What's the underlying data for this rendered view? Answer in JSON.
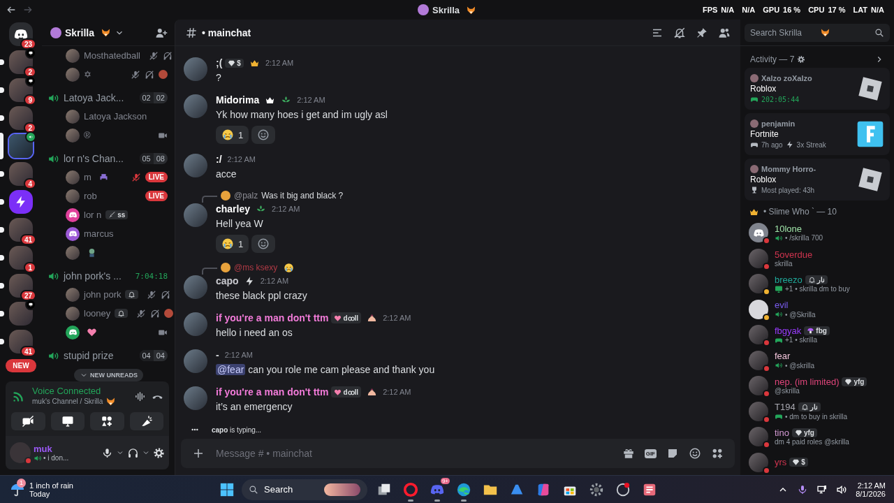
{
  "topbar": {
    "title": "Skrilla",
    "stats": [
      {
        "label": "FPS",
        "value": "N/A"
      },
      {
        "value": "N/A"
      },
      {
        "label": "GPU",
        "value": "16 %"
      },
      {
        "label": "CPU",
        "value": "17 %"
      },
      {
        "label": "LAT",
        "value": "N/A"
      }
    ]
  },
  "servers": [
    {
      "kind": "home",
      "badge": "23",
      "unread": false,
      "selected": false
    },
    {
      "kind": "photo",
      "badge": "2",
      "unread": true,
      "selected": false
    },
    {
      "kind": "photo",
      "badge": "9",
      "unread": true,
      "selected": false
    },
    {
      "kind": "photo",
      "badge": "2",
      "unread": true,
      "selected": false
    },
    {
      "kind": "photo",
      "unread": false,
      "selected": true
    },
    {
      "kind": "photo",
      "badge": "4",
      "unread": true,
      "selected": false
    },
    {
      "kind": "logo",
      "unread": true,
      "selected": false
    },
    {
      "kind": "photo",
      "badge": "41",
      "unread": true,
      "selected": false
    },
    {
      "kind": "photo",
      "badge": "1",
      "unread": true,
      "selected": false
    },
    {
      "kind": "photo",
      "badge": "27",
      "unread": true,
      "selected": false
    },
    {
      "kind": "photo",
      "unread": true,
      "selected": false
    },
    {
      "kind": "photo",
      "badge": "41",
      "unread": true,
      "selected": false
    }
  ],
  "new_pill": "NEW",
  "sidebar": {
    "server_name": "Skrilla",
    "channels": [
      {
        "members": [
          {
            "name": "Mosthatedball",
            "kind": "photo",
            "muted": true,
            "deafened": true,
            "camera": false,
            "activity": false
          },
          {
            "name": "✡",
            "kind": "photo",
            "muted": true,
            "deafened": true,
            "camera": false,
            "activity": true
          }
        ]
      },
      {
        "name": "Latoya Jack...",
        "count": [
          "02",
          "02"
        ],
        "members": [
          {
            "name": "Latoya Jackson",
            "kind": "photo",
            "muted": false,
            "deafened": false,
            "camera": false,
            "activity": false
          },
          {
            "name": "®",
            "kind": "photo",
            "muted": false,
            "deafened": false,
            "camera": true,
            "activity": false
          }
        ]
      },
      {
        "name": "lor n's Chan...",
        "count": [
          "05",
          "08"
        ],
        "members": [
          {
            "name": "m",
            "kind": "photo",
            "muted": true,
            "deafened": false,
            "camera": false,
            "activity": false,
            "live": "LIVE"
          },
          {
            "name": "rob",
            "kind": "photo",
            "muted": false,
            "deafened": false,
            "camera": false,
            "activity": false,
            "live": "LIVE"
          },
          {
            "name": "lor n",
            "tag": {
              "text": "ss"
            },
            "kind": "discord",
            "color": "#e0409b",
            "muted": false,
            "deafened": false,
            "camera": false,
            "activity": false
          },
          {
            "name": "marcus",
            "kind": "discord",
            "color": "#9b59d6",
            "muted": false,
            "deafened": false,
            "camera": false,
            "activity": false
          },
          {
            "kind": "photo",
            "muted": false,
            "deafened": false,
            "camera": false,
            "activity": false
          }
        ]
      },
      {
        "name": "john pork's ...",
        "timer": "7:04:18",
        "members": [
          {
            "name": "john pork",
            "tag": true,
            "kind": "photo",
            "muted": true,
            "deafened": true,
            "camera": false,
            "activity": false
          },
          {
            "name": "looney",
            "tag": true,
            "kind": "photo",
            "muted": true,
            "deafened": true,
            "camera": false,
            "activity": true
          },
          {
            "kind": "discord",
            "color": "#23a55a",
            "muted": false,
            "deafened": false,
            "camera": true,
            "activity": false
          }
        ]
      },
      {
        "name": "stupid prize",
        "count": [
          "04",
          "04"
        ]
      }
    ],
    "unreads": "NEW UNREADS",
    "voice": {
      "title": "Voice Connected",
      "subtitle": "muk's Channel / Skrilla"
    },
    "user": {
      "name": "muk",
      "status": "• i don..."
    }
  },
  "channel": {
    "name": "• mainchat",
    "search_placeholder": "Search Skrilla"
  },
  "messages": [
    {
      "author": ";(",
      "color": "#dbdee1",
      "tag": {
        "text": "$"
      },
      "time": "2:12 AM",
      "text": "?"
    },
    {
      "author": "Midorima",
      "color": "#ffffff",
      "time": "2:12 AM",
      "text": "Yk how many hoes i get and im ugly asl",
      "reactions": [
        {
          "count": "1"
        }
      ]
    },
    {
      "author": ":/",
      "color": "#ffffff",
      "time": "2:12 AM",
      "text": "acce"
    },
    {
      "reply": {
        "author": "@palz",
        "color": "#8e8e96",
        "text": "Was it big and black ?"
      },
      "author": "charley",
      "color": "#ffffff",
      "time": "2:12 AM",
      "text": "Hell yea W",
      "reactions": [
        {
          "count": "1"
        }
      ]
    },
    {
      "reply": {
        "author": "@ms ksexy",
        "color": "#b03a45"
      },
      "author": "capo",
      "color": "#c9c9cf",
      "time": "2:12 AM",
      "text": "these black ppl crazy"
    },
    {
      "author": "if you're a man don't ttm",
      "color": "#f27bd9",
      "tag": {
        "text": "dꝏll"
      },
      "time": "2:12 AM",
      "text": "hello i need an os"
    },
    {
      "author": "-",
      "color": "#dbdee1",
      "time": "2:12 AM",
      "mention": "@fear",
      "text": "can you role me cam please and thank you"
    },
    {
      "author": "if you're a man don't ttm",
      "color": "#f27bd9",
      "tag": {
        "text": "dꝏll"
      },
      "time": "2:12 AM",
      "text": "it’s an emergency"
    }
  ],
  "typing": "**capo** is typing...",
  "composer": {
    "placeholder": "Message # • mainchat",
    "gif": "GIF"
  },
  "activity": {
    "title": "Activity — 7",
    "cards": [
      {
        "user": "Xalzo zoXalzo",
        "game": "Roblox",
        "kind": "timer",
        "detail": "202:05:44"
      },
      {
        "user": "penjamin",
        "game": "Fortnite",
        "kind": "recent",
        "detail": "7h ago",
        "extra": "3x Streak"
      },
      {
        "user": "Mommy Horro-",
        "game": "Roblox",
        "kind": "played",
        "detail": "Most played: 43h"
      }
    ]
  },
  "members": {
    "title": "• Slime Who ` — 10",
    "items": [
      {
        "name": "10lone",
        "color": "#9fe3a8",
        "kind": "discord",
        "idle": false,
        "activity": {
          "kind": "voice",
          "text": "• /skrilla 700"
        }
      },
      {
        "name": "5overdue",
        "color": "#d0344f",
        "kind": "photo",
        "idle": false,
        "activity": {
          "text": "skrilla"
        }
      },
      {
        "name": "breezo",
        "color": "#1fa99a",
        "kind": "photo",
        "idle": true,
        "tag": {
          "text": "نار"
        },
        "activity": {
          "kind": "screen",
          "text": "+1 • skrilla dm to buy"
        }
      },
      {
        "name": "evil",
        "color": "#7a5cf0",
        "kind": "blank",
        "idle": true,
        "activity": {
          "kind": "voice",
          "text": "• @Skrilla"
        }
      },
      {
        "name": "fbgyak",
        "color": "#9a3cff",
        "kind": "photo",
        "idle": false,
        "tag": {
          "text": "fbg"
        },
        "activity": {
          "kind": "game",
          "text": "+1 • skrilla"
        }
      },
      {
        "name": "fear",
        "color": "#f4c6dc",
        "kind": "photo",
        "idle": false,
        "activity": {
          "kind": "voice",
          "text": "• @skrilla"
        }
      },
      {
        "name": "nep. (im limited)",
        "color": "#e0457b",
        "kind": "photo",
        "idle": false,
        "tag": {
          "text": "yfg"
        },
        "activity": {
          "text": "@skrilla"
        }
      },
      {
        "name": "T194",
        "color": "#a8a8b0",
        "kind": "photo",
        "idle": false,
        "tag": {
          "text": "نار"
        },
        "activity": {
          "kind": "game",
          "text": "• dm to buy in skrilla"
        }
      },
      {
        "name": "tino",
        "color": "#d49ad4",
        "kind": "photo",
        "idle": false,
        "tag": {
          "text": "yfg"
        },
        "activity": {
          "text": "dm 4 paid roles @skrilla"
        }
      },
      {
        "name": "yrs",
        "color": "#d0344f",
        "kind": "photo",
        "idle": false,
        "tag": {
          "text": "$"
        }
      }
    ]
  },
  "taskbar": {
    "weather": {
      "text": "1 inch of rain",
      "sub": "Today",
      "badge": "1"
    },
    "search": "Search",
    "apps": [
      {
        "kind": "taskview",
        "running": false
      },
      {
        "kind": "opera",
        "running": true
      },
      {
        "kind": "discord",
        "running": true,
        "badge": "9+"
      },
      {
        "kind": "edge",
        "running": true
      },
      {
        "kind": "folder",
        "running": false
      },
      {
        "kind": "azure",
        "running": false
      },
      {
        "kind": "copilot",
        "running": false
      },
      {
        "kind": "store",
        "running": false
      },
      {
        "kind": "settings",
        "running": false
      },
      {
        "kind": "record",
        "running": false
      },
      {
        "kind": "snip",
        "running": false
      }
    ],
    "time": "2:12 AM",
    "date": "8/1/2026"
  }
}
